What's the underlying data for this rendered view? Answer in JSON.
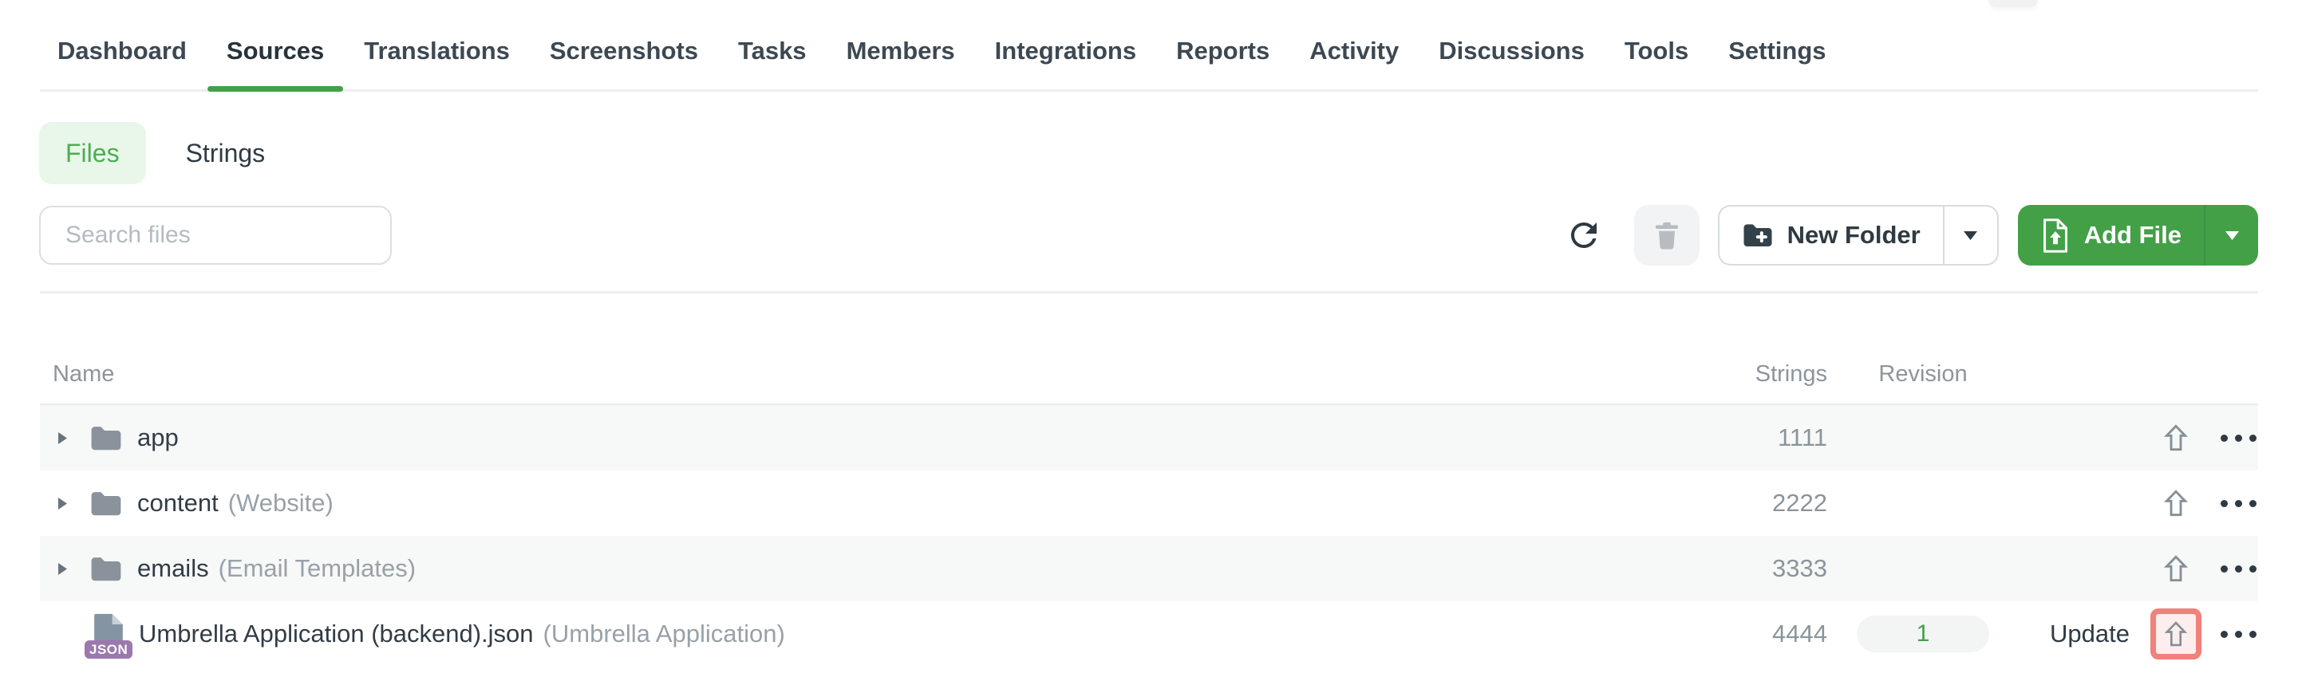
{
  "nav": {
    "tabs": [
      "Dashboard",
      "Sources",
      "Translations",
      "Screenshots",
      "Tasks",
      "Members",
      "Integrations",
      "Reports",
      "Activity",
      "Discussions",
      "Tools",
      "Settings"
    ],
    "active_tab": "Sources"
  },
  "view_toggle": {
    "files_label": "Files",
    "strings_label": "Strings",
    "active": "Files"
  },
  "toolbar": {
    "search_placeholder": "Search files",
    "search_value": "",
    "new_folder_label": "New Folder",
    "add_file_label": "Add File"
  },
  "table": {
    "headers": {
      "name": "Name",
      "strings": "Strings",
      "revision": "Revision"
    },
    "rows": [
      {
        "type": "folder",
        "name": "app",
        "note": "",
        "strings": "1111"
      },
      {
        "type": "folder",
        "name": "content",
        "note": "(Website)",
        "strings": "2222"
      },
      {
        "type": "folder",
        "name": "emails",
        "note": "(Email Templates)",
        "strings": "3333"
      },
      {
        "type": "file",
        "file_badge": "JSON",
        "name": "Umbrella Application (backend).json",
        "note": "(Umbrella Application)",
        "strings": "4444",
        "revision": "1",
        "action_label": "Update",
        "highlighted": true
      }
    ]
  },
  "colors": {
    "accent_green": "#43a047",
    "accent_green_light": "#e9f6ea",
    "highlight_red_border": "#f0817b",
    "highlight_red_bg": "#fdeeed",
    "json_badge_purple": "#9b78ae",
    "row_alt_bg": "#f7f8f8"
  }
}
